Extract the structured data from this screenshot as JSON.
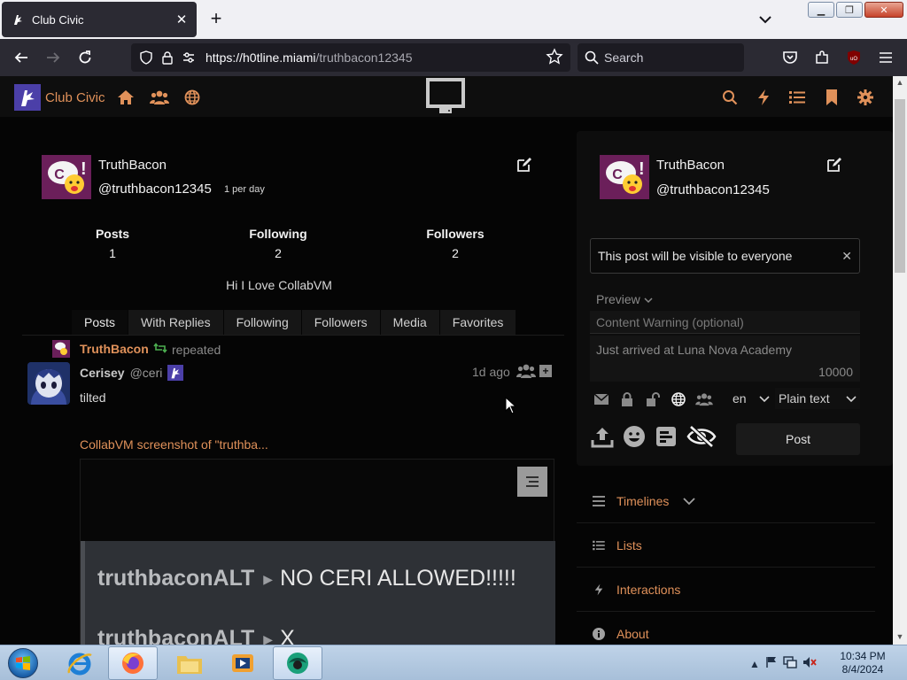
{
  "browser": {
    "tab_title": "Club Civic",
    "new_tab_label": "+",
    "url_host": "https://h0tline.miami",
    "url_path": "/truthbacon12345",
    "search_placeholder": "Search"
  },
  "app": {
    "brand_name": "Club Civic",
    "accent_color": "#e0915a"
  },
  "profile": {
    "display_name": "TruthBacon",
    "handle": "@truthbacon12345",
    "rate": "1 per day",
    "stats": [
      {
        "label": "Posts",
        "value": "1"
      },
      {
        "label": "Following",
        "value": "2"
      },
      {
        "label": "Followers",
        "value": "2"
      }
    ],
    "bio": "Hi I Love CollabVM",
    "tabs": [
      "Posts",
      "With Replies",
      "Following",
      "Followers",
      "Media",
      "Favorites"
    ]
  },
  "post": {
    "reposter": "TruthBacon",
    "repost_text": "repeated",
    "author_name": "Cerisey",
    "author_handle": "@ceri",
    "time": "1d ago",
    "body": "tilted",
    "link_text": "CollabVM screenshot of \"truthba...",
    "card_line1_user": "truthbaconALT",
    "card_line1_msg": "NO CERI ALLOWED!!!!!",
    "card_line2_user": "truthbaconALT",
    "card_line2_msg": "X"
  },
  "compose": {
    "display_name": "TruthBacon",
    "handle": "@truthbacon12345",
    "visibility_notice": "This post will be visible to everyone",
    "preview_label": "Preview",
    "cw_placeholder": "Content Warning (optional)",
    "body_text": "Just arrived at Luna Nova Academy",
    "char_count": "10000",
    "language": "en",
    "format": "Plain text",
    "post_button": "Post"
  },
  "sidenav": [
    {
      "label": "Timelines",
      "icon": "list-icon"
    },
    {
      "label": "Lists",
      "icon": "list-icon"
    },
    {
      "label": "Interactions",
      "icon": "bolt-icon"
    },
    {
      "label": "About",
      "icon": "info-icon"
    }
  ],
  "taskbar": {
    "time": "10:34 PM",
    "date": "8/4/2024"
  }
}
